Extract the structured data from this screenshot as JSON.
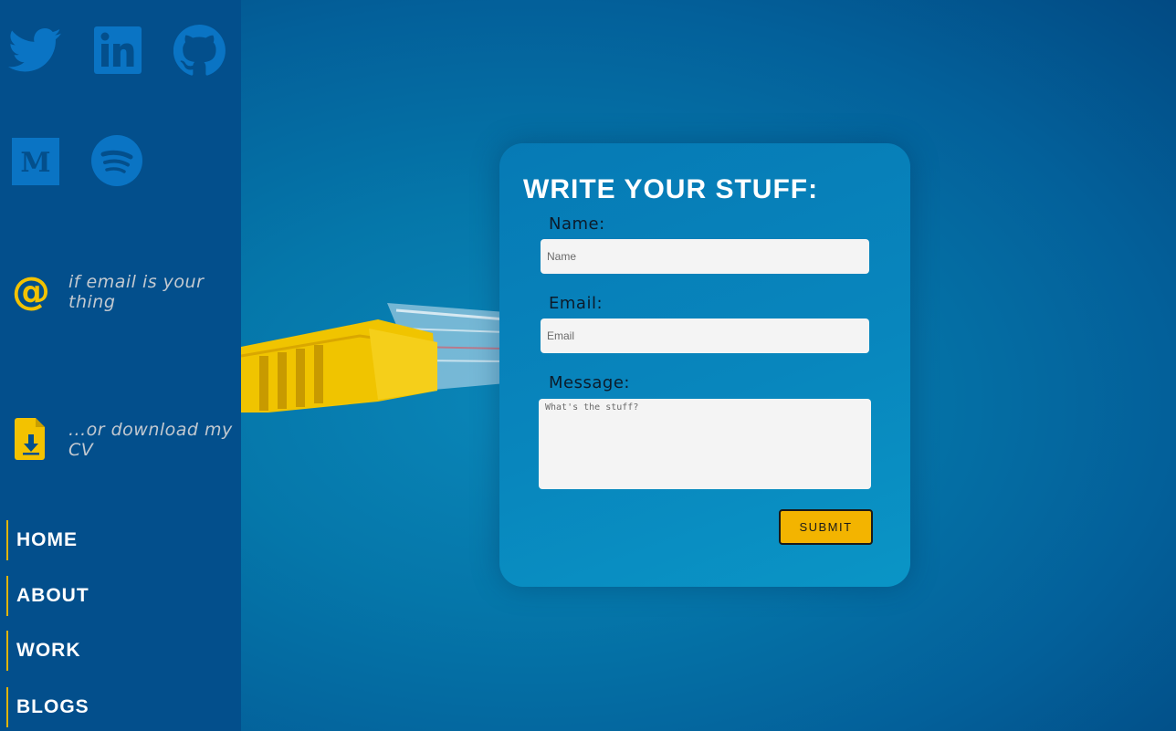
{
  "colors": {
    "sidebar_bg": "#034f8c",
    "icon_blue": "#0a74c4",
    "accent_yellow": "#f3c200",
    "nav_border": "#e2b500",
    "card_bg": "#0886bd",
    "submit_bg": "#f3b400"
  },
  "sidebar": {
    "social_icons": [
      "twitter-icon",
      "linkedin-icon",
      "github-icon",
      "medium-icon",
      "spotify-icon"
    ],
    "email": {
      "icon": "at-sign-icon",
      "text": "if email is your thing"
    },
    "download": {
      "icon": "file-download-icon",
      "text": "...or download my CV"
    },
    "nav": [
      {
        "label": "HOME"
      },
      {
        "label": "ABOUT"
      },
      {
        "label": "WORK"
      },
      {
        "label": "BLOGS"
      }
    ]
  },
  "form": {
    "title": "WRITE YOUR STUFF:",
    "name_label": "Name:",
    "name_placeholder": "Name",
    "email_label": "Email:",
    "email_placeholder": "Email",
    "message_label": "Message:",
    "message_placeholder": "What's the stuff?",
    "submit_label": "SUBMIT"
  }
}
